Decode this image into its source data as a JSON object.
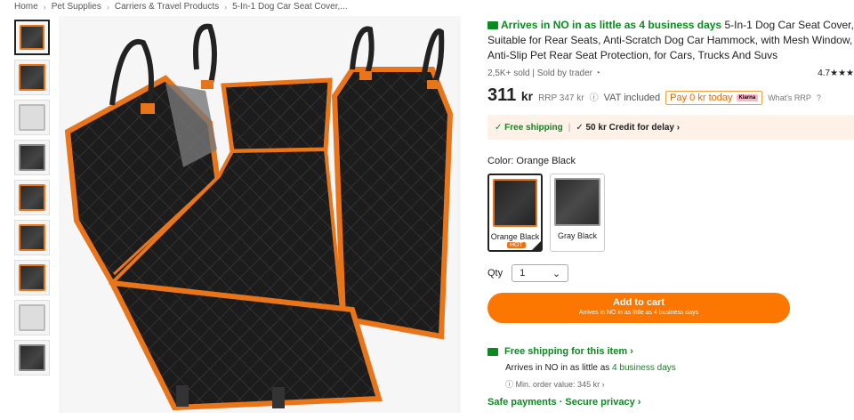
{
  "breadcrumb": [
    "Home",
    "Pet Supplies",
    "Carriers & Travel Products",
    "5-In-1 Dog Car Seat Cover,..."
  ],
  "product": {
    "arrives": "Arrives in NO in as little as 4 business days",
    "title": " 5-In-1 Dog Car Seat Cover, Suitable for Rear Seats, Anti-Scratch Dog Car Hammock, with Mesh Window, Anti-Slip Pet Rear Seat Protection, for Cars, Trucks And Suvs",
    "sold": "2,5K+ sold",
    "sold_by": "Sold by trader",
    "rating": "4.7★★★",
    "price": "311",
    "currency": "kr",
    "rrp": "RRP 347 kr",
    "vat": "VAT included",
    "pay_today": "Pay 0 kr today",
    "klarna": "Klarna",
    "whats_rrp": "What's RRP"
  },
  "promo": {
    "free_shipping": "✓ Free shipping",
    "credit": "✓ 50 kr Credit for delay ›"
  },
  "color": {
    "label": "Color: Orange Black",
    "options": [
      {
        "label": "Orange Black",
        "badge": "HOT"
      },
      {
        "label": "Gray Black"
      }
    ]
  },
  "qty": {
    "label": "Qty",
    "value": "1"
  },
  "cart": {
    "label": "Add to cart",
    "sub": "Arrives in NO in as little as 4 business days"
  },
  "shipping": {
    "title": "Free shipping for this item ›",
    "line_prefix": "Arrives in NO in as little as ",
    "line_days": "4 business days",
    "min_order": "Min. order value: 345 kr ›",
    "safe": "Safe payments · Secure privacy ›"
  },
  "colors": {
    "accent": "#fb7701",
    "green": "#0a8a1f"
  }
}
